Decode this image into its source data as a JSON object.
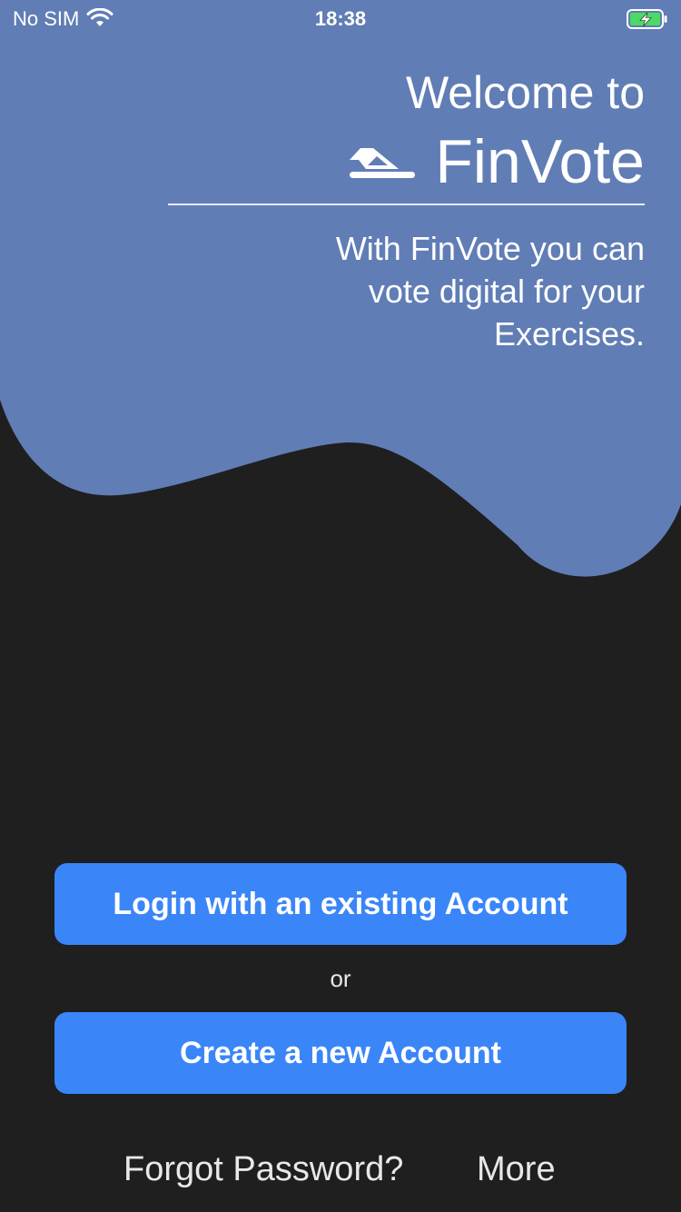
{
  "status_bar": {
    "carrier": "No SIM",
    "time": "18:38",
    "wifi_icon": "wifi-icon",
    "battery_icon": "battery-charging-icon",
    "battery_color": "#4cd964"
  },
  "header": {
    "welcome": "Welcome to",
    "brand_name": "FinVote",
    "logo_icon": "boat-logo-icon",
    "tagline_lines": [
      "With FinVote you can",
      "vote digital for your",
      "Exercises."
    ]
  },
  "actions": {
    "login_label": "Login with an existing Account",
    "or_label": "or",
    "create_label": "Create a new Account",
    "forgot_label": "Forgot Password?",
    "more_label": "More"
  },
  "colors": {
    "background": "#1f1f1f",
    "wave": "#607db5",
    "button": "#3a86f8",
    "text": "#ffffff"
  }
}
